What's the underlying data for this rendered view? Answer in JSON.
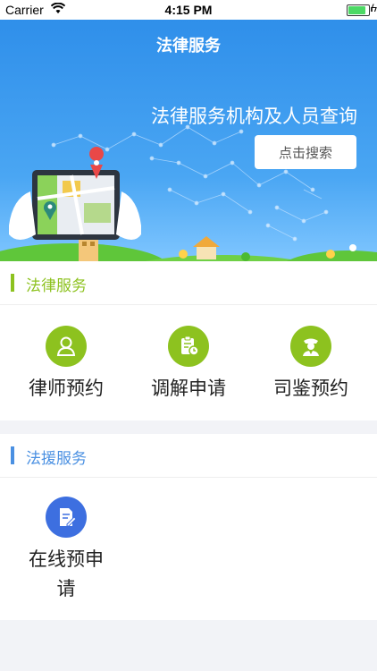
{
  "status_bar": {
    "carrier": "Carrier",
    "time": "4:15 PM"
  },
  "header": {
    "title": "法律服务"
  },
  "banner": {
    "query_text": "法律服务机构及人员查询",
    "search_button": "点击搜索"
  },
  "legal_section": {
    "title": "法律服务",
    "accent": "#8dc21f",
    "items": [
      {
        "label": "律师预约",
        "icon": "lawyer-icon"
      },
      {
        "label": "调解申请",
        "icon": "mediation-icon"
      },
      {
        "label": "司鉴预约",
        "icon": "judicial-icon"
      }
    ]
  },
  "aid_section": {
    "title": "法援服务",
    "accent": "#4a90e2",
    "items": [
      {
        "label": "在线预申请",
        "icon": "document-edit-icon"
      }
    ]
  }
}
